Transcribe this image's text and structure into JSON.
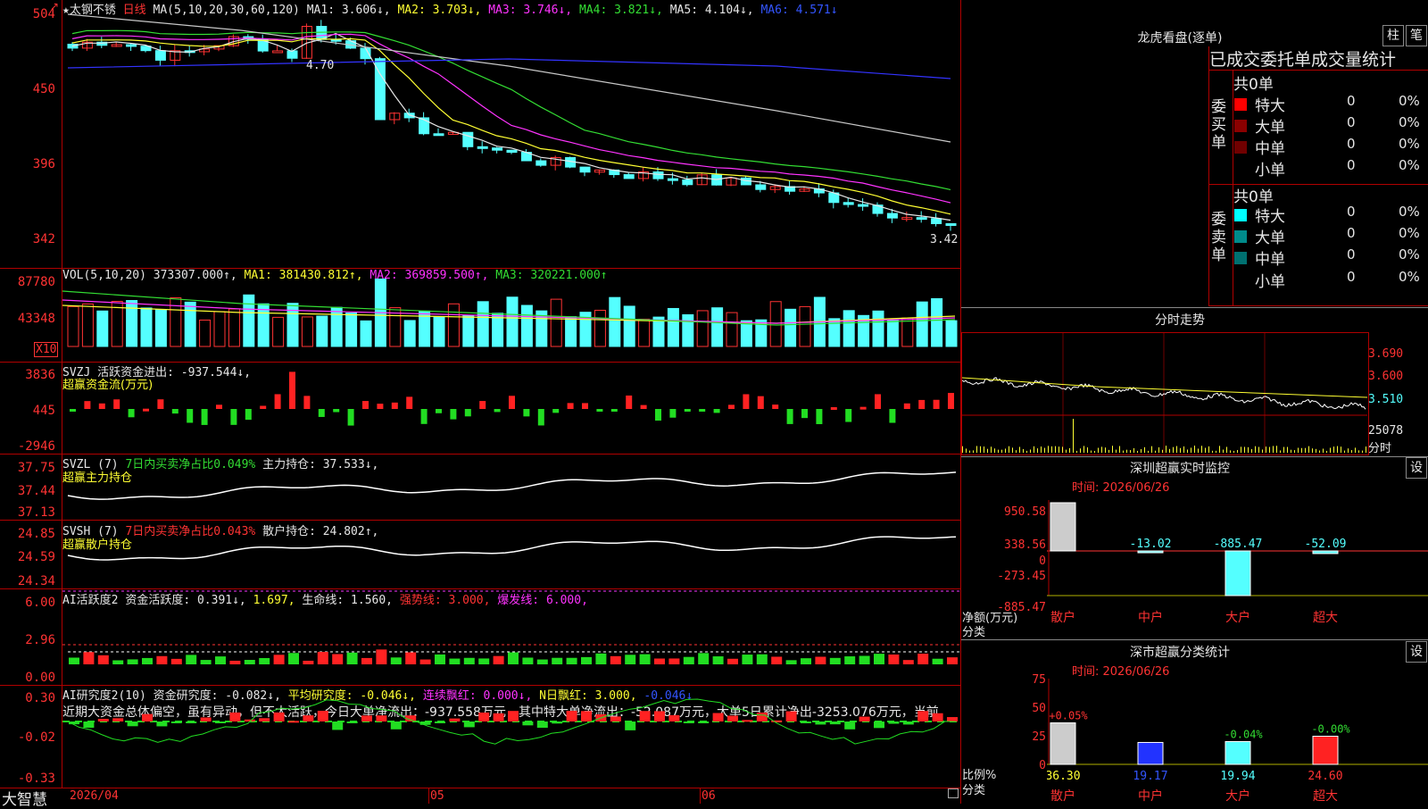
{
  "stock": {
    "title": "太钢不锈",
    "period": "日线",
    "ma_label": "MA(5,10,20,30,60,120)",
    "ma1": "MA1: 3.606↓,",
    "ma2": "MA2: 3.703↓,",
    "ma3": "MA3: 3.746↓,",
    "ma4": "MA4: 3.821↓,",
    "ma5": "MA5: 4.104↓,",
    "ma6": "MA6: 4.571↓",
    "price_axis": [
      "504",
      "450",
      "396",
      "342"
    ],
    "high_marker": "4.70",
    "low_marker": "3.42"
  },
  "vol": {
    "label": "VOL(5,10,20)",
    "value": "373307.000↑,",
    "ma1": "MA1: 381430.812↑,",
    "ma2": "MA2: 369859.500↑,",
    "ma3": "MA3: 320221.000↑",
    "axis": [
      "87780",
      "43348"
    ],
    "unit": "X10"
  },
  "svzj": {
    "label": "SVZJ",
    "title": "活跃资金进出: -937.544↓,",
    "sub": "超赢资金流(万元)",
    "axis": [
      "3836",
      "445",
      "-2946"
    ]
  },
  "svzl": {
    "label": "SVZL (7)",
    "t1": "7日内买卖净占比0.049%",
    "t2": "主力持仓: 37.533↓,",
    "sub": "超赢主力持仓",
    "axis": [
      "37.75",
      "37.44",
      "37.13"
    ]
  },
  "svsh": {
    "label": "SVSH (7)",
    "t1": "7日内买卖净占比0.043%",
    "t2": "散户持仓: 24.802↑,",
    "sub": "超赢散户持仓",
    "axis": [
      "24.85",
      "24.59",
      "24.34"
    ]
  },
  "ai1": {
    "label": "AI活跃度2",
    "t1": "资金活跃度: 0.391↓,",
    "t2": "1.697,",
    "t3": "生命线: 1.560,",
    "t4": "强势线: 3.000,",
    "t5": "爆发线: 6.000,",
    "axis": [
      "6.00",
      "2.96",
      "0.00"
    ]
  },
  "ai2": {
    "label": "AI研究度2(10)",
    "t1": "资金研究度: -0.082↓,",
    "t2": "平均研究度: -0.046↓,",
    "t3": "连续飘红: 0.000↓,",
    "t4": "N日飘红: 3.000,",
    "t5": "-0.046↓",
    "desc": "近期大资金总体偏空，虽有异动，但不太活跃，今日大单净流出：-937.558万元，其中特大单净流出：-52.087万元，大单5日累计净出-3253.076万元，当前",
    "axis": [
      "0.30",
      "-0.02",
      "-0.33"
    ]
  },
  "bottom": {
    "brand": "大智慧",
    "date_start": "2026/04",
    "m05": "05",
    "m06": "06"
  },
  "longhu": {
    "title": "龙虎看盘(逐单)",
    "btn1": "柱",
    "btn2": "笔",
    "subtitle": "已成交委托单成交量统计",
    "buy_label": "委买单",
    "sell_label": "委卖单",
    "buy_total": "共0单",
    "sell_total": "共0单",
    "rows": [
      {
        "name": "特大",
        "val": "0",
        "pct": "0%"
      },
      {
        "name": "大单",
        "val": "0",
        "pct": "0%"
      },
      {
        "name": "中单",
        "val": "0",
        "pct": "0%"
      },
      {
        "name": "小单",
        "val": "0",
        "pct": "0%"
      }
    ]
  },
  "fenshi": {
    "title": "分时走势",
    "axis": [
      "3.690",
      "3.600",
      "3.510"
    ],
    "vol": "25078",
    "unit": "分时"
  },
  "monitor": {
    "title": "深圳超赢实时监控",
    "btn": "设",
    "time": "时间: 2026/06/26",
    "axis": [
      "950.58",
      "338.56",
      "0",
      "-273.45",
      "-885.47"
    ],
    "ylabel": "净额(万元)",
    "xlabel": "分类",
    "bars": [
      {
        "cat": "散户",
        "value": 950.58,
        "label": "950.58"
      },
      {
        "cat": "中户",
        "value": -13.02,
        "label": "-13.02"
      },
      {
        "cat": "大户",
        "value": -885.47,
        "label": "-885.47"
      },
      {
        "cat": "超大",
        "value": -52.09,
        "label": "-52.09"
      }
    ]
  },
  "classify": {
    "title": "深市超赢分类统计",
    "btn": "设",
    "time": "时间: 2026/06/26",
    "axis": [
      "75",
      "50",
      "25",
      "0"
    ],
    "ylabel": "比例%",
    "xlabel": "分类",
    "bars": [
      {
        "cat": "散户",
        "value": 36.3,
        "label": "36.30",
        "change": "+0.05%"
      },
      {
        "cat": "中户",
        "value": 19.17,
        "label": "19.17",
        "change": ""
      },
      {
        "cat": "大户",
        "value": 19.94,
        "label": "19.94",
        "change": "-0.04%"
      },
      {
        "cat": "超大",
        "value": 24.6,
        "label": "24.60",
        "change": "-0.00%"
      }
    ]
  }
}
